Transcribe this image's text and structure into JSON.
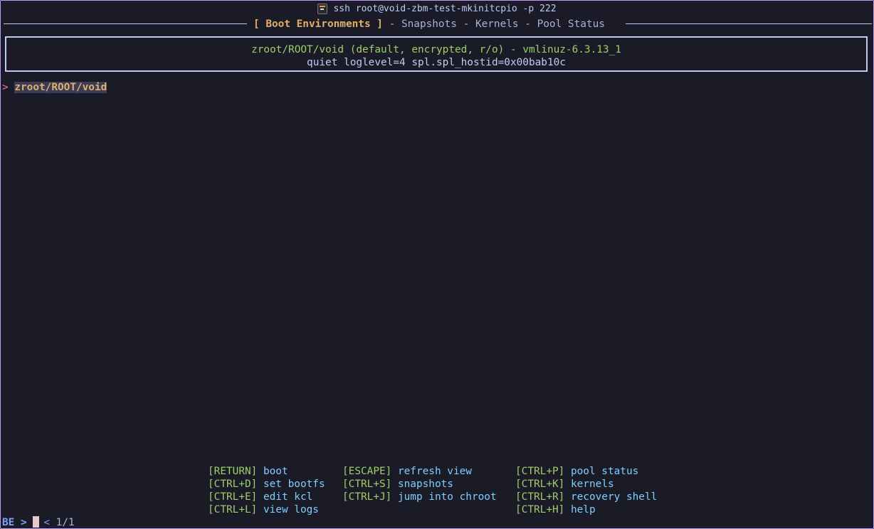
{
  "window": {
    "title": "ssh root@void-zbm-test-mkinitcpio -p 222",
    "title_icon": "terminal-icon"
  },
  "tabs": {
    "active": "[ Boot Environments ]",
    "separator": " - ",
    "items": [
      "Snapshots",
      "Kernels",
      "Pool Status"
    ]
  },
  "info": {
    "line1": "zroot/ROOT/void (default, encrypted, r/o) - vmlinuz-6.3.13_1",
    "line2": "quiet loglevel=4 spl.spl_hostid=0x00bab10c"
  },
  "list": {
    "pointer": ">",
    "items": [
      "zroot/ROOT/void"
    ]
  },
  "help": [
    {
      "key": "[RETURN]",
      "desc": "boot"
    },
    {
      "key": "[ESCAPE]",
      "desc": "refresh view"
    },
    {
      "key": "[CTRL+P]",
      "desc": "pool status"
    },
    {
      "key": "[CTRL+D]",
      "desc": "set bootfs"
    },
    {
      "key": "[CTRL+S]",
      "desc": "snapshots"
    },
    {
      "key": "[CTRL+K]",
      "desc": "kernels"
    },
    {
      "key": "[CTRL+E]",
      "desc": "edit kcl"
    },
    {
      "key": "[CTRL+J]",
      "desc": "jump into chroot"
    },
    {
      "key": "[CTRL+R]",
      "desc": "recovery shell"
    },
    {
      "key": "[CTRL+L]",
      "desc": "view logs"
    },
    {
      "key": "",
      "desc": ""
    },
    {
      "key": "[CTRL+H]",
      "desc": "help"
    }
  ],
  "prompt": {
    "label": "BE >",
    "count_marker": "<",
    "count": "1/1"
  },
  "colors": {
    "background": "#1a1b26",
    "border": "#bb9af7",
    "active_tab": "#e0af68",
    "key": "#9ece6a",
    "desc": "#7dcfff",
    "pointer": "#f7768e",
    "prompt": "#7aa2f7"
  }
}
